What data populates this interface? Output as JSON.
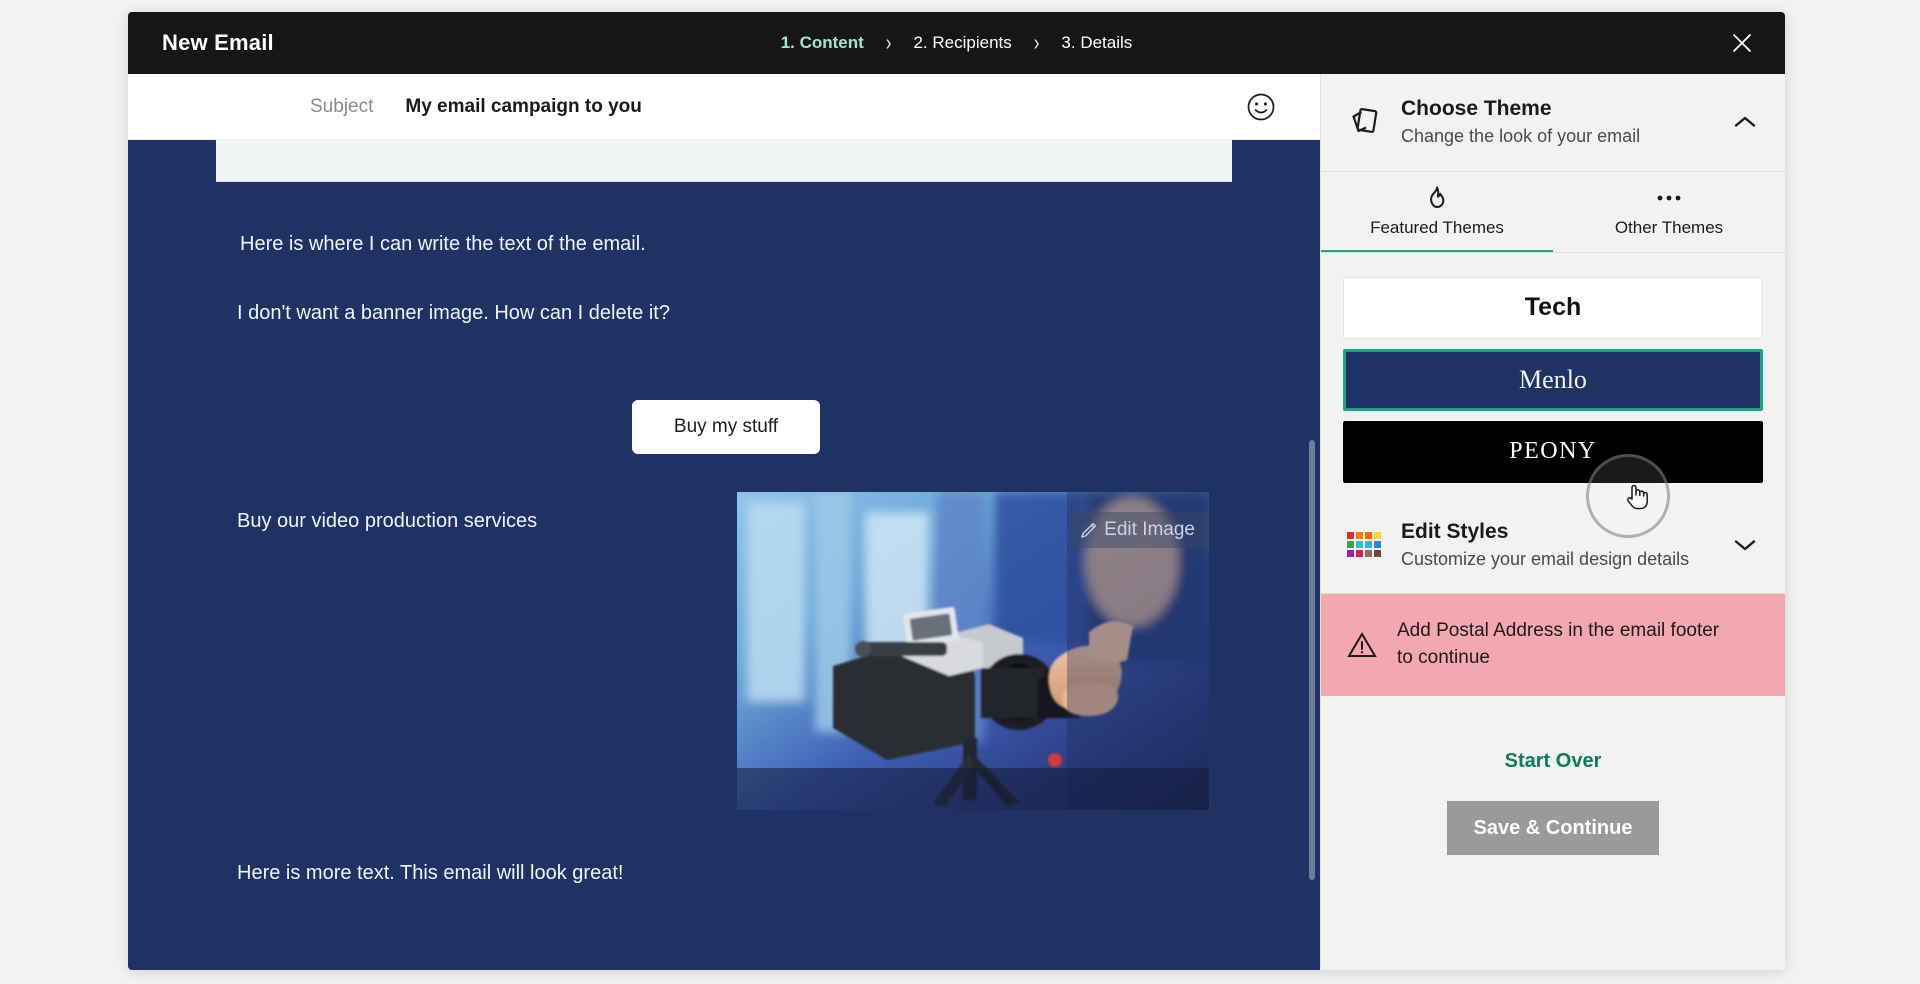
{
  "window": {
    "title": "New Email",
    "close_icon": "close-icon"
  },
  "steps": [
    {
      "label": "1. Content",
      "active": true
    },
    {
      "label": "2. Recipients",
      "active": false
    },
    {
      "label": "3. Details",
      "active": false
    }
  ],
  "step_separator": "›",
  "subject": {
    "label": "Subject",
    "value": "My email campaign to you",
    "emoji_icon": "smiley-face-icon"
  },
  "email_body": {
    "background_color": "#1e3263",
    "paragraph_1": "Here is where I can write the text of the email.",
    "paragraph_2": "I don't want a banner image. How can I delete it?",
    "cta_label": "Buy my stuff",
    "paragraph_3": "Buy our video production services",
    "paragraph_4": "Here is more text. This email will look great!",
    "image_overlay_label": "Edit Image"
  },
  "panel": {
    "choose_theme": {
      "title": "Choose Theme",
      "subtitle": "Change the look of your email",
      "icon": "theme-cards-icon",
      "chevron": "chevron-up-icon",
      "expanded": true
    },
    "tabs": [
      {
        "label": "Featured Themes",
        "icon": "flame-icon",
        "active": true
      },
      {
        "label": "Other Themes",
        "icon": "ellipsis-icon",
        "active": false
      }
    ],
    "themes": [
      {
        "name": "Tech",
        "selected": false,
        "bg": "#ffffff",
        "fg": "#121212"
      },
      {
        "name": "Menlo",
        "selected": true,
        "bg": "#1e3263",
        "fg": "#eef2fb"
      },
      {
        "name": "PEONY",
        "selected": false,
        "bg": "#000000",
        "fg": "#ffffff"
      }
    ],
    "edit_styles": {
      "title": "Edit Styles",
      "subtitle": "Customize your email design details",
      "icon": "color-palette-grid-icon",
      "chevron": "chevron-down-icon",
      "expanded": false
    },
    "warning": {
      "icon": "warning-triangle-icon",
      "text": "Add Postal Address in the email footer to continue",
      "background_color": "#f3a8b0"
    },
    "footer": {
      "start_over_label": "Start Over",
      "save_continue_label": "Save & Continue",
      "save_continue_disabled": true
    }
  },
  "colors": {
    "accent_teal": "#1aa584",
    "step_active": "#9fe7cd",
    "start_over": "#0f7a5e",
    "topbar": "#161616",
    "panel_bg": "#f2f2f0",
    "disabled_button": "#9a9a9a"
  }
}
